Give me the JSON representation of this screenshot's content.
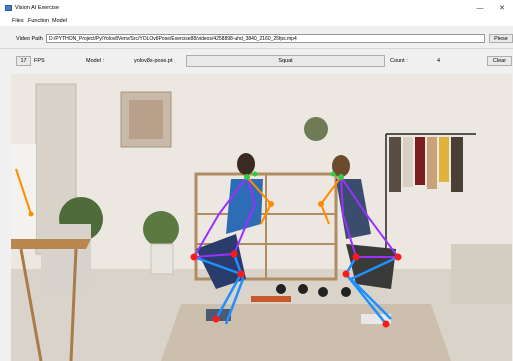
{
  "window": {
    "title": "Vision AI Exercise",
    "minimize_glyph": "—",
    "close_glyph": "✕"
  },
  "menu": {
    "items": [
      "Files",
      "Function",
      "Model"
    ]
  },
  "path_row": {
    "label": "Video Path",
    "value": "D:/PYTHON_Project/Py/Yolov8Venv/Src/YOLOv8Pose/Exercise88/videos/4258898-uhd_3840_2160_25fps.mp4",
    "browse_label": "Piese"
  },
  "status_row": {
    "fps_value": "17",
    "fps_label": "FPS",
    "model_label": "Model :",
    "model_value": "yolov8s-pose.pt",
    "exercise_value": "Squat",
    "count_label": "Count :",
    "count_value": "4",
    "clear_label": "Clear"
  },
  "colors": {
    "skeleton_upper": "#9b30ff",
    "skeleton_arms": "#ff8c00",
    "skeleton_legs": "#1e90ff",
    "keypoint": "#ff1a1a",
    "head_keypoint": "#2ecc40"
  },
  "icons": {
    "app": "app-icon"
  }
}
